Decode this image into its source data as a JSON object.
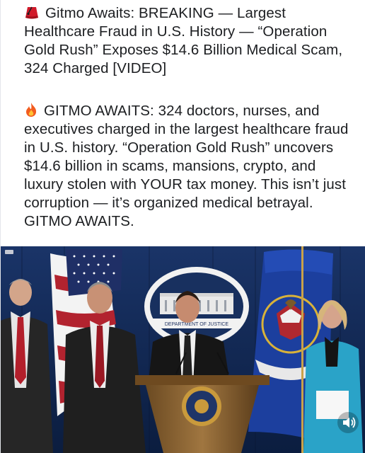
{
  "post": {
    "headline_emoji": "red-fez-emoji",
    "headline": "Gitmo Awaits: BREAKING — Largest Healthcare Fraud in U.S. History — “Operation Gold Rush” Exposes $14.6 Billion Medical Scam, 324 Charged [VIDEO]",
    "body_emoji": "fire-emoji",
    "body": "GITMO AWAITS: 324 doctors, nurses, and executives charged in the largest healthcare fraud in U.S. history. “Operation Gold Rush” uncovers $14.6 billion in scams, mansions, crypto, and luxury stolen with YOUR tax money. This isn’t just corruption — it’s organized medical betrayal. GITMO AWAITS."
  },
  "video": {
    "backdrop_sign": "DEPARTMENT OF JUSTICE",
    "mute_icon": "speaker-icon"
  }
}
